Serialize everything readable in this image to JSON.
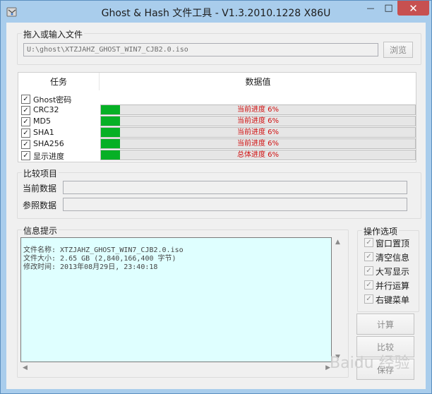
{
  "window": {
    "title": "Ghost & Hash 文件工具 - V1.3.2010.1228 X86U",
    "controls": {
      "minimize": "—",
      "maximize": "□",
      "close": "✕"
    }
  },
  "file_section": {
    "label": "拖入或输入文件",
    "path": "U:\\ghost\\XTZJAHZ_GHOST_WIN7_CJB2.0.iso",
    "browse_label": "浏览"
  },
  "task_table": {
    "header_task": "任务",
    "header_value": "数据值",
    "rows": [
      {
        "name": "Ghost密码",
        "checked": true,
        "progress_text": ""
      },
      {
        "name": "CRC32",
        "checked": true,
        "progress_text": "当前进度 6%",
        "progress": 0.06
      },
      {
        "name": "MD5",
        "checked": true,
        "progress_text": "当前进度 6%",
        "progress": 0.06
      },
      {
        "name": "SHA1",
        "checked": true,
        "progress_text": "当前进度 6%",
        "progress": 0.06
      },
      {
        "name": "SHA256",
        "checked": true,
        "progress_text": "当前进度 6%",
        "progress": 0.06
      },
      {
        "name": "显示进度",
        "checked": true,
        "progress_text": "总体进度 6%",
        "progress": 0.06
      }
    ]
  },
  "compare_section": {
    "label": "比较项目",
    "current_label": "当前数据",
    "reference_label": "参照数据"
  },
  "info_section": {
    "label": "信息提示",
    "lines": [
      "文件名称: XTZJAHZ_GHOST_WIN7_CJB2.0.iso",
      "文件大小: 2.65 GB (2,840,166,400 字节)",
      "修改时间: 2013年08月29日, 23:40:18"
    ]
  },
  "options_section": {
    "label": "操作选项",
    "options": [
      {
        "label": "窗口置顶",
        "checked": true
      },
      {
        "label": "清空信息",
        "checked": true
      },
      {
        "label": "大写显示",
        "checked": true
      },
      {
        "label": "并行运算",
        "checked": true
      },
      {
        "label": "右键菜单",
        "checked": true
      }
    ],
    "calc_label": "计算",
    "compare_label": "比较",
    "save_label": "保存"
  },
  "watermark": "Baidu 经验",
  "colors": {
    "progress_fill": "#06b025",
    "progress_text": "#d01010",
    "info_bg": "#dfffff",
    "title_bar": "#a9cdec"
  }
}
